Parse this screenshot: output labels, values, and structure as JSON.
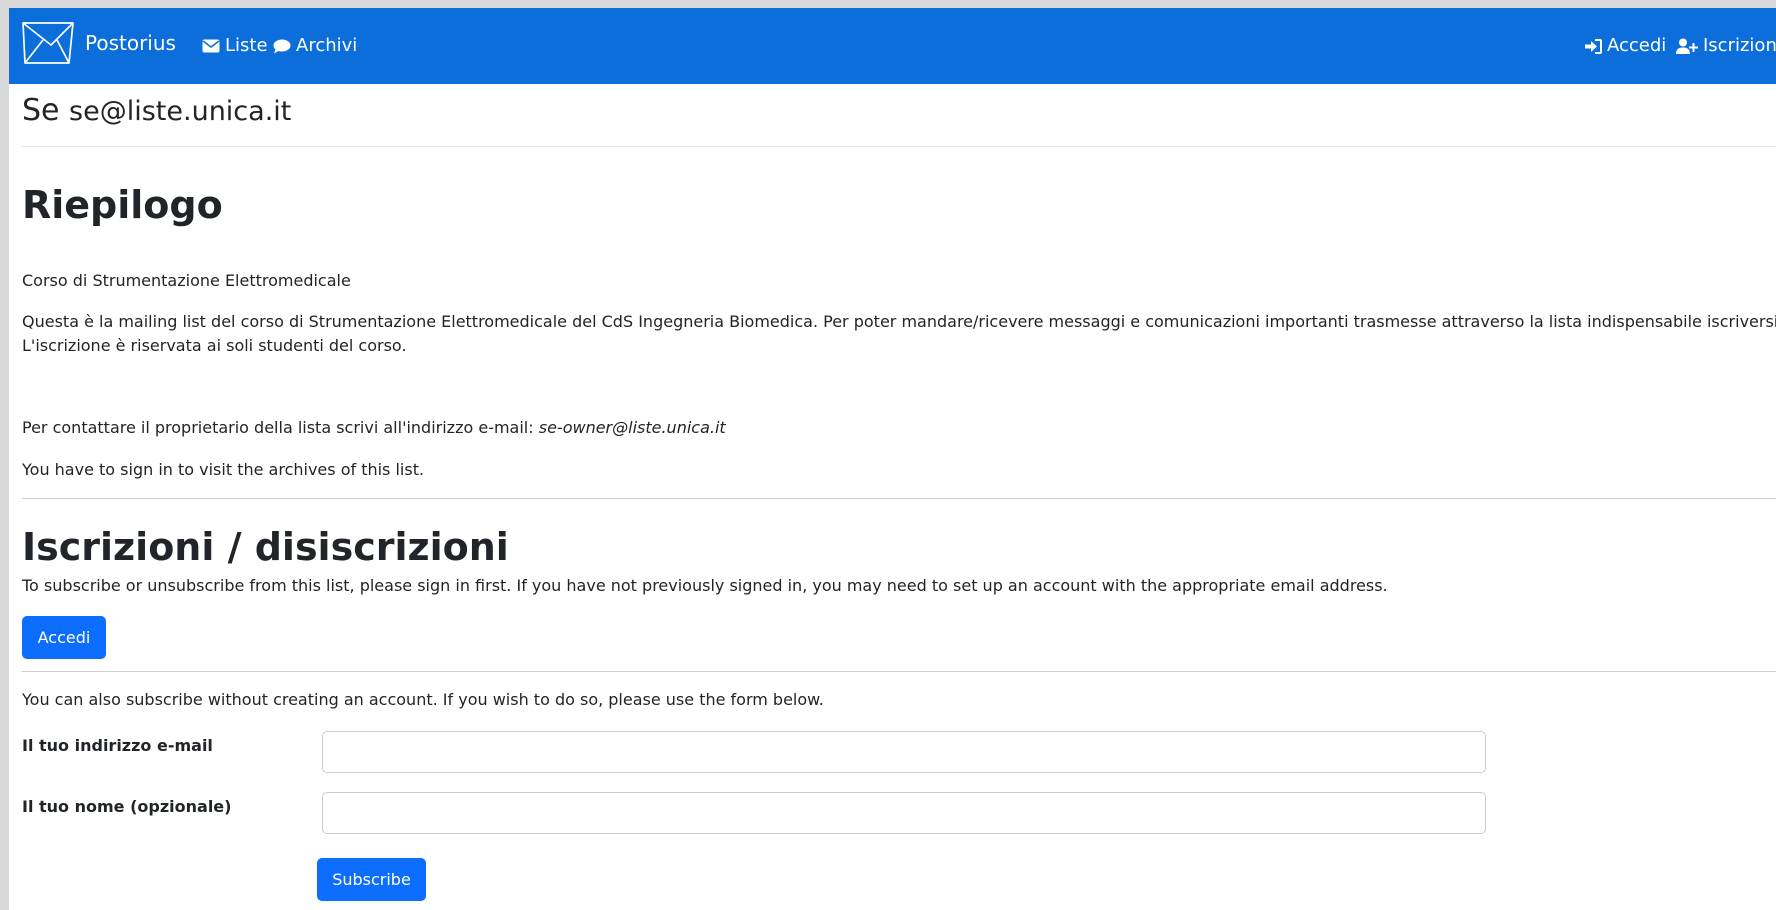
{
  "navbar": {
    "brand": "Postorius",
    "links": {
      "liste": "Liste",
      "archivi": "Archivi",
      "accedi": "Accedi",
      "iscrizione": "Iscrizione"
    },
    "icons": {
      "brand": "envelope-logo-icon",
      "liste": "envelope-icon",
      "archivi": "speech-bubble-icon",
      "accedi": "sign-in-icon",
      "iscrizione": "user-plus-icon"
    },
    "colors": {
      "background": "#0b6edb",
      "text": "#ffffff"
    }
  },
  "list_header": {
    "name": "Se",
    "address": "se@liste.unica.it"
  },
  "summary": {
    "heading": "Riepilogo",
    "course": "Corso di Strumentazione Elettromedicale",
    "description_line1": "Questa è la mailing list del corso di Strumentazione Elettromedicale del CdS Ingegneria Biomedica. Per poter mandare/ricevere messaggi e comunicazioni importanti trasmesse attraverso la lista indispensabile iscriversi",
    "description_line2": "L'iscrizione è riservata ai soli studenti del corso.",
    "contact_prefix": "Per contattare il proprietario della lista scrivi all'indirizzo e-mail:",
    "owner_email": "se-owner@liste.unica.it",
    "archives_notice": "You have to sign in to visit the archives of this list."
  },
  "subscriptions": {
    "heading": "Iscrizioni / disiscrizioni",
    "instructions": "To subscribe or unsubscribe from this list, please sign in first. If you have not previously signed in, you may need to set up an account with the appropriate email address.",
    "signin_button": "Accedi",
    "without_account": "You can also subscribe without creating an account. If you wish to do so, please use the form below.",
    "email_label": "Il tuo indirizzo e-mail",
    "email_value": "",
    "email_placeholder": "",
    "name_label": "Il tuo nome (opzionale)",
    "name_value": "",
    "name_placeholder": "",
    "subscribe_button": "Subscribe",
    "button_color": "#0d6efd"
  }
}
